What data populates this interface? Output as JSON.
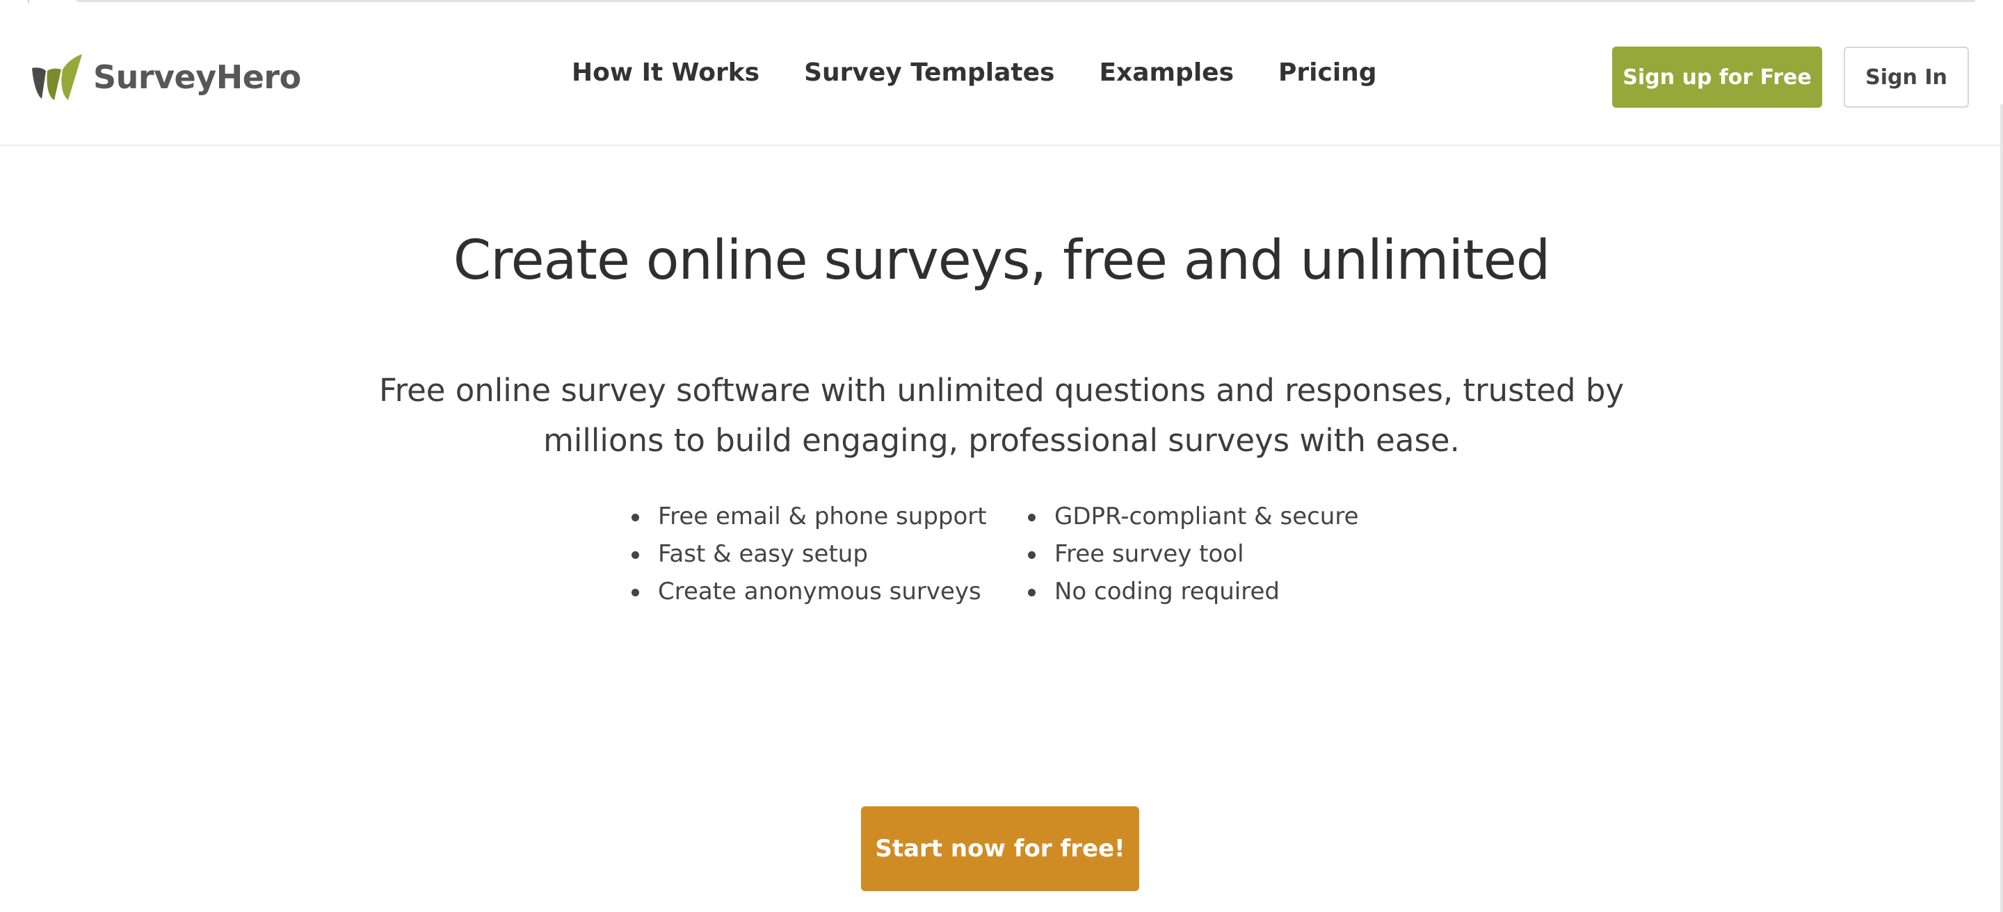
{
  "header": {
    "logo_text": "SurveyHero",
    "nav": [
      {
        "label": "How It Works"
      },
      {
        "label": "Survey Templates"
      },
      {
        "label": "Examples"
      },
      {
        "label": "Pricing"
      }
    ],
    "signup_label": "Sign up for Free",
    "signin_label": "Sign In"
  },
  "hero": {
    "title": "Create online surveys, free and unlimited",
    "subtitle": "Free online survey software with unlimited questions and responses, trusted by millions to build engaging, professional surveys with ease.",
    "features_left": [
      "Free email & phone support",
      "Fast & easy setup",
      "Create anonymous surveys"
    ],
    "features_right": [
      "GDPR-compliant & secure",
      "Free survey tool",
      "No coding required"
    ],
    "cta_label": "Start now for free!"
  },
  "colors": {
    "brand_green": "#96a83a",
    "logo_dark": "#4a4a4a",
    "cta_orange": "#d08c24",
    "text_dark": "#333333"
  },
  "icons": {
    "logo_mark": "surveyhero-leaf-logo-icon"
  }
}
